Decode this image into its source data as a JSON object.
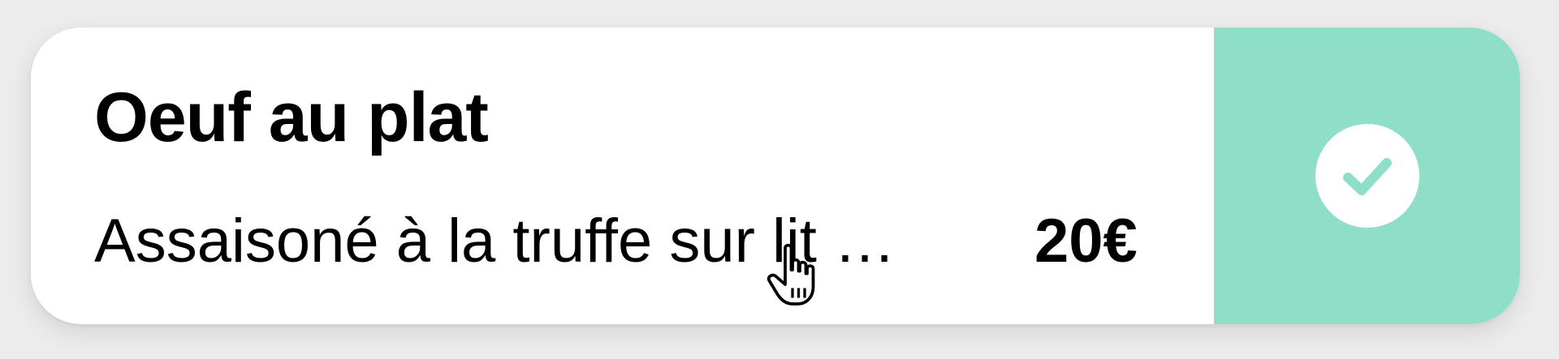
{
  "card": {
    "title": "Oeuf au plat",
    "description": "Assaisoné à la truffe sur lit …",
    "price": "20€",
    "selected": true
  },
  "colors": {
    "background": "#ececec",
    "card": "#ffffff",
    "accent": "#8fdec8",
    "text": "#000000"
  },
  "icons": {
    "check": "check-icon",
    "cursor": "hand-pointer-cursor-icon"
  }
}
